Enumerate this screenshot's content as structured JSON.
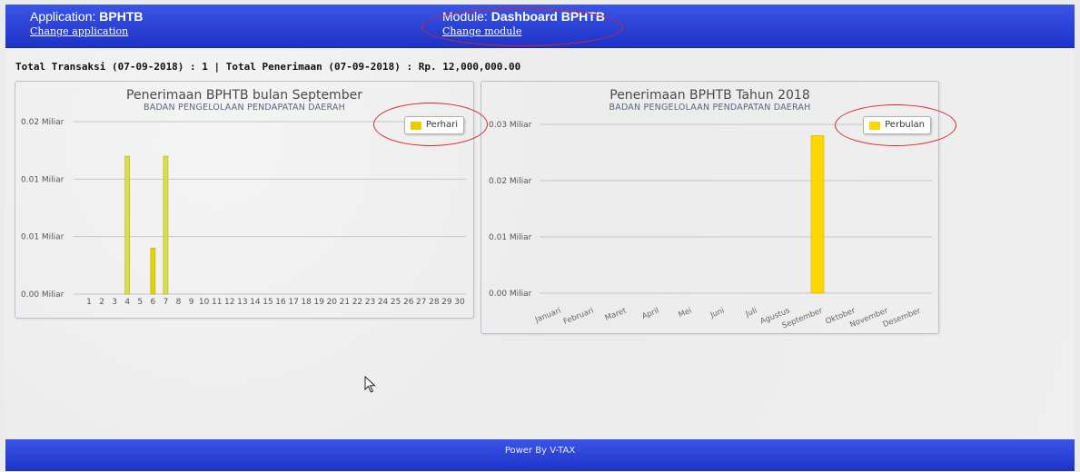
{
  "header": {
    "application_prefix": "Application: ",
    "application_name": "BPHTB",
    "change_application": "Change application",
    "module_prefix": "Module: ",
    "module_name": "Dashboard BPHTB",
    "change_module": "Change module"
  },
  "summary": "Total Transaksi (07-09-2018) : 1 | Total Penerimaan (07-09-2018) : Rp. 12,000,000.00",
  "footer": "Power By V-TAX",
  "colors": {
    "accent": "#2a44d8",
    "bar": "#ffd700",
    "bar_alt": "#c8d63a",
    "highlight": "#d9262c"
  },
  "chart_data": [
    {
      "type": "bar",
      "title": "Penerimaan BPHTB bulan September",
      "subtitle": "BADAN PENGELOLAAN PENDAPATAN DAERAH",
      "categories": [
        "1",
        "2",
        "3",
        "4",
        "5",
        "6",
        "7",
        "8",
        "9",
        "10",
        "11",
        "12",
        "13",
        "14",
        "15",
        "16",
        "17",
        "18",
        "19",
        "20",
        "21",
        "22",
        "23",
        "24",
        "25",
        "26",
        "27",
        "28",
        "29",
        "30"
      ],
      "series": [
        {
          "name": "Perhari",
          "values": [
            0,
            0,
            0,
            12000000,
            0,
            4000000,
            12000000,
            0,
            0,
            0,
            0,
            0,
            0,
            0,
            0,
            0,
            0,
            0,
            0,
            0,
            0,
            0,
            0,
            0,
            0,
            0,
            0,
            0,
            0,
            0
          ]
        }
      ],
      "y_ticks": [
        {
          "value": 0,
          "label": "0.00 Miliar"
        },
        {
          "value": 5000000,
          "label": "0.01 Miliar"
        },
        {
          "value": 10000000,
          "label": "0.01 Miliar"
        },
        {
          "value": 15000000,
          "label": "0.02 Miliar"
        }
      ],
      "ylim": [
        0,
        15000000
      ],
      "legend_position": "top-right",
      "grid": true
    },
    {
      "type": "bar",
      "title": "Penerimaan BPHTB Tahun 2018",
      "subtitle": "BADAN PENGELOLAAN PENDAPATAN DAERAH",
      "categories": [
        "Januari",
        "Februari",
        "Maret",
        "April",
        "Mei",
        "Juni",
        "Juli",
        "Agustus",
        "September",
        "Oktober",
        "November",
        "Desember"
      ],
      "series": [
        {
          "name": "Perbulan",
          "values": [
            0,
            0,
            0,
            0,
            0,
            0,
            0,
            0,
            28000000,
            0,
            0,
            0
          ]
        }
      ],
      "y_ticks": [
        {
          "value": 0,
          "label": "0.00 Miliar"
        },
        {
          "value": 10000000,
          "label": "0.01 Miliar"
        },
        {
          "value": 20000000,
          "label": "0.02 Miliar"
        },
        {
          "value": 30000000,
          "label": "0.03 Miliar"
        }
      ],
      "ylim": [
        0,
        30000000
      ],
      "legend_position": "top-right",
      "grid": true
    }
  ]
}
